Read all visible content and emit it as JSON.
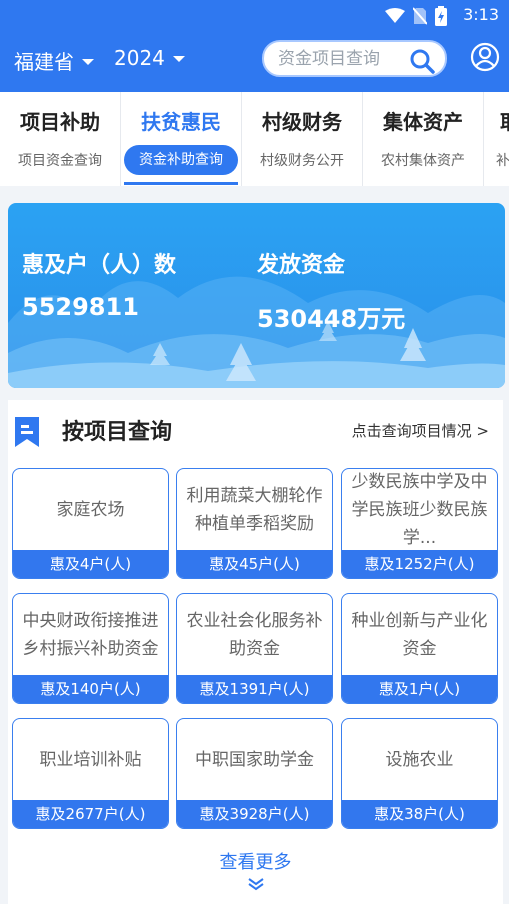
{
  "status": {
    "time": "3:13"
  },
  "header": {
    "province": "福建省",
    "year": "2024",
    "search_placeholder": "资金项目查询"
  },
  "tabs": [
    {
      "title": "项目补助",
      "sub": "项目资金查询"
    },
    {
      "title": "扶贫惠民",
      "sub": "资金补助查询"
    },
    {
      "title": "村级财务",
      "sub": "村级财务公开"
    },
    {
      "title": "集体资产",
      "sub": "农村集体资产"
    },
    {
      "title": "耶",
      "sub": "补"
    }
  ],
  "banner": {
    "households_label": "惠及户（人）数",
    "households_value": "5529811",
    "funds_label": "发放资金",
    "funds_value": "530448万元"
  },
  "section": {
    "title": "按项目查询",
    "link": "点击查询项目情况 >",
    "more": "查看更多"
  },
  "cards": [
    {
      "name": "家庭农场",
      "count": "惠及4户(人)"
    },
    {
      "name": "利用蔬菜大棚轮作种植单季稻奖励",
      "count": "惠及45户(人)"
    },
    {
      "name": "少数民族中学及中学民族班少数民族学...",
      "count": "惠及1252户(人)"
    },
    {
      "name": "中央财政衔接推进乡村振兴补助资金",
      "count": "惠及140户(人)"
    },
    {
      "name": "农业社会化服务补助资金",
      "count": "惠及1391户(人)"
    },
    {
      "name": "种业创新与产业化资金",
      "count": "惠及1户(人)"
    },
    {
      "name": "职业培训补贴",
      "count": "惠及2677户(人)"
    },
    {
      "name": "中职国家助学金",
      "count": "惠及3928户(人)"
    },
    {
      "name": "设施农业",
      "count": "惠及38户(人)"
    }
  ]
}
